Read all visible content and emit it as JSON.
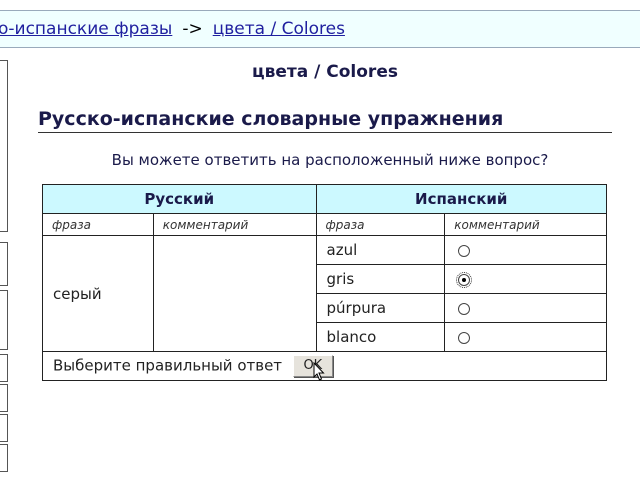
{
  "breadcrumb": {
    "parent": "о-испанские фразы",
    "separator": "->",
    "current": "цвета / Colores"
  },
  "page": {
    "subtitle": "цвета / Colores",
    "heading": "Русско-испанские словарные упражнения",
    "question": "Вы можете ответить на расположенный ниже вопрос?"
  },
  "table": {
    "col_russian": "Русский",
    "col_spanish": "Испанский",
    "sub_phrase_ru": "фраза",
    "sub_comment_ru": "комментарий",
    "sub_phrase_es": "фраза",
    "sub_comment_es": "комментарий",
    "russian_word": "серый",
    "options": [
      {
        "label": "azul",
        "selected": false
      },
      {
        "label": "gris",
        "selected": true
      },
      {
        "label": "púrpura",
        "selected": false
      },
      {
        "label": "blanco",
        "selected": false
      }
    ],
    "footer_label": "Выберите правильный ответ",
    "ok_label": "OK"
  },
  "colors": {
    "header_bg": "#ccf9ff",
    "topbar_bg": "#f0ffff",
    "link": "#1f1f9f",
    "title_text": "#1a1a4a"
  }
}
